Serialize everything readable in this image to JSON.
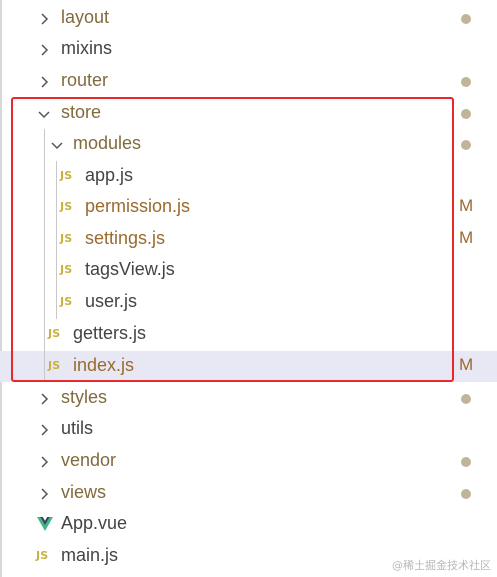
{
  "explorer": {
    "items": [
      {
        "label": "layout",
        "kind": "folder",
        "expanded": false,
        "status": "dot"
      },
      {
        "label": "mixins",
        "kind": "folder",
        "expanded": false,
        "status": ""
      },
      {
        "label": "router",
        "kind": "folder",
        "expanded": false,
        "status": "dot"
      },
      {
        "label": "store",
        "kind": "folder",
        "expanded": true,
        "status": "dot"
      },
      {
        "label": "modules",
        "kind": "folder",
        "expanded": true,
        "status": "dot"
      },
      {
        "label": "app.js",
        "kind": "js",
        "icon": "JS",
        "status": ""
      },
      {
        "label": "permission.js",
        "kind": "js",
        "icon": "JS",
        "status": "M"
      },
      {
        "label": "settings.js",
        "kind": "js",
        "icon": "JS",
        "status": "M"
      },
      {
        "label": "tagsView.js",
        "kind": "js",
        "icon": "JS",
        "status": ""
      },
      {
        "label": "user.js",
        "kind": "js",
        "icon": "JS",
        "status": ""
      },
      {
        "label": "getters.js",
        "kind": "js",
        "icon": "JS",
        "status": ""
      },
      {
        "label": "index.js",
        "kind": "js",
        "icon": "JS",
        "status": "M",
        "selected": true
      },
      {
        "label": "styles",
        "kind": "folder",
        "expanded": false,
        "status": "dot"
      },
      {
        "label": "utils",
        "kind": "folder",
        "expanded": false,
        "status": ""
      },
      {
        "label": "vendor",
        "kind": "folder",
        "expanded": false,
        "status": "dot"
      },
      {
        "label": "views",
        "kind": "folder",
        "expanded": false,
        "status": "dot"
      },
      {
        "label": "App.vue",
        "kind": "vue",
        "status": ""
      },
      {
        "label": "main.js",
        "kind": "js",
        "icon": "JS",
        "status": ""
      }
    ]
  },
  "colors": {
    "js_icon": "#c9b23b",
    "vue_icon_outer": "#41b883",
    "vue_icon_inner": "#35495e",
    "modified_badge": "#9a6a2e",
    "status_dot": "#c2b49b",
    "highlight_border": "#e8282b",
    "selection_bg": "#e8e8f5"
  },
  "watermark": "@稀土掘金技术社区"
}
